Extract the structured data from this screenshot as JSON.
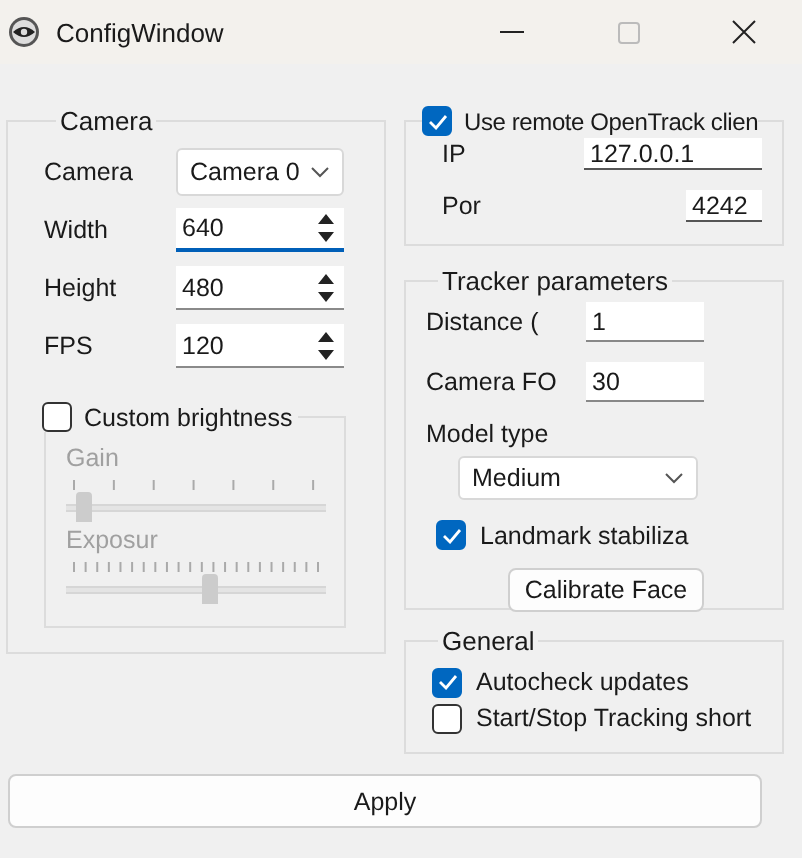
{
  "window": {
    "title": "ConfigWindow"
  },
  "camera_group": {
    "title": "Camera",
    "camera": {
      "label": "Camera",
      "value": "Camera 0"
    },
    "spinboxes": [
      {
        "label": "Width",
        "value": "640",
        "focused": true
      },
      {
        "label": "Height",
        "value": "480",
        "focused": false
      },
      {
        "label": "FPS",
        "value": "120",
        "focused": false
      }
    ],
    "brightness": {
      "label": "Custom brightness",
      "checked": false,
      "sliders": [
        {
          "label": "Gain",
          "kind": "coarse",
          "level": 0.04,
          "disabled": true
        },
        {
          "label": "Exposur",
          "kind": "fine",
          "level": 0.56,
          "disabled": true
        }
      ]
    }
  },
  "remote_group": {
    "label": "Use remote OpenTrack clien",
    "checked": true,
    "fields": [
      {
        "label": "IP",
        "value": "127.0.0.1"
      },
      {
        "label": "Por",
        "value": "4242"
      }
    ]
  },
  "tracker_group": {
    "title": "Tracker parameters",
    "fields": [
      {
        "label": "Distance (",
        "value": "1"
      },
      {
        "label": "Camera FO",
        "value": "30"
      }
    ],
    "model": {
      "label": "Model type",
      "value": "Medium"
    },
    "stabilization": {
      "label": "Landmark stabiliza",
      "checked": true
    },
    "button": "Calibrate Face"
  },
  "general_group": {
    "title": "General",
    "checkboxes": [
      {
        "label": "Autocheck updates",
        "checked": true
      },
      {
        "label": "Start/Stop Tracking short",
        "checked": false
      }
    ]
  },
  "apply_button": "Apply"
}
